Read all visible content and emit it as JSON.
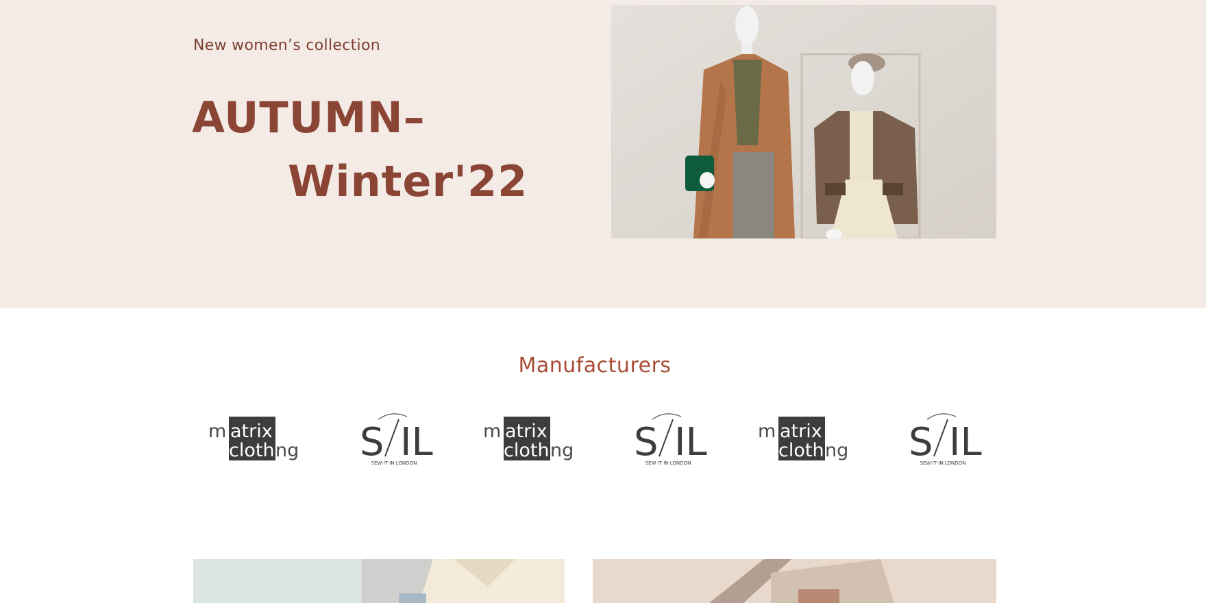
{
  "hero": {
    "subtitle": "New women’s collection",
    "title_line1": "AUTUMN–",
    "title_line2": "Winter'22"
  },
  "manufacturers": {
    "title": "Manufacturers",
    "logos": [
      {
        "name": "matrix clothing"
      },
      {
        "name": "SIL",
        "tagline": "SEW·IT·IN·LONDON"
      },
      {
        "name": "matrix clothing"
      },
      {
        "name": "SIL",
        "tagline": "SEW·IT·IN·LONDON"
      },
      {
        "name": "matrix clothing"
      },
      {
        "name": "SIL",
        "tagline": "SEW·IT·IN·LONDON"
      }
    ]
  },
  "colors": {
    "hero_bg": "#f4ebe7",
    "accent": "#8a4534",
    "heading": "#a84c36",
    "logo": "#3d3d3d"
  }
}
